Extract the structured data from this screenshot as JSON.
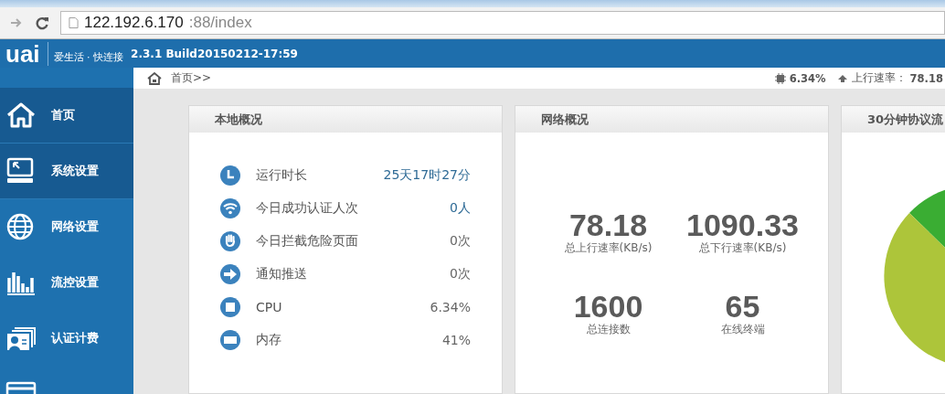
{
  "browser": {
    "url_host": "122.192.6.170",
    "url_rest": ":88/index"
  },
  "header": {
    "logo": "uai",
    "slogan": "爱生活 · 快连接",
    "version": "2.3.1 Build20150212-17:59"
  },
  "breadcrumb": "首页>>",
  "status": {
    "cpu": "6.34%",
    "upload_label": "上行速率：",
    "upload_value": "78.18"
  },
  "sidebar": {
    "items": [
      {
        "label": "首页",
        "kind": "home",
        "selected": true
      },
      {
        "label": "系统设置",
        "kind": "monitor",
        "selected": true
      },
      {
        "label": "网络设置",
        "kind": "globe",
        "selected": false
      },
      {
        "label": "流控设置",
        "kind": "bars",
        "selected": false
      },
      {
        "label": "认证计费",
        "kind": "card",
        "selected": false
      },
      {
        "kind": "window",
        "selected": false
      }
    ]
  },
  "local_overview": {
    "title": "本地概况",
    "rows": [
      {
        "kind": "clock",
        "label": "运行时长",
        "value": "25天17时27分",
        "highlighted": true
      },
      {
        "kind": "wifi",
        "label": "今日成功认证人次",
        "value": "0人",
        "highlighted": true
      },
      {
        "kind": "hand",
        "label": "今日拦截危险页面",
        "value": "0次",
        "highlighted": false
      },
      {
        "kind": "arrow",
        "label": "通知推送",
        "value": "0次",
        "highlighted": false
      },
      {
        "kind": "chip",
        "label": "CPU",
        "value": "6.34%",
        "highlighted": false
      },
      {
        "kind": "memory",
        "label": "内存",
        "value": "41%",
        "highlighted": false
      }
    ]
  },
  "network_overview": {
    "title": "网络概况",
    "stats": [
      {
        "value": "78.18",
        "label": "总上行速率(KB/s)"
      },
      {
        "value": "1090.33",
        "label": "总下行速率(KB/s)"
      },
      {
        "value": "1600",
        "label": "总连接数"
      },
      {
        "value": "65",
        "label": "在线终端"
      }
    ]
  },
  "protocol_panel": {
    "title": "30分钟协议流"
  }
}
